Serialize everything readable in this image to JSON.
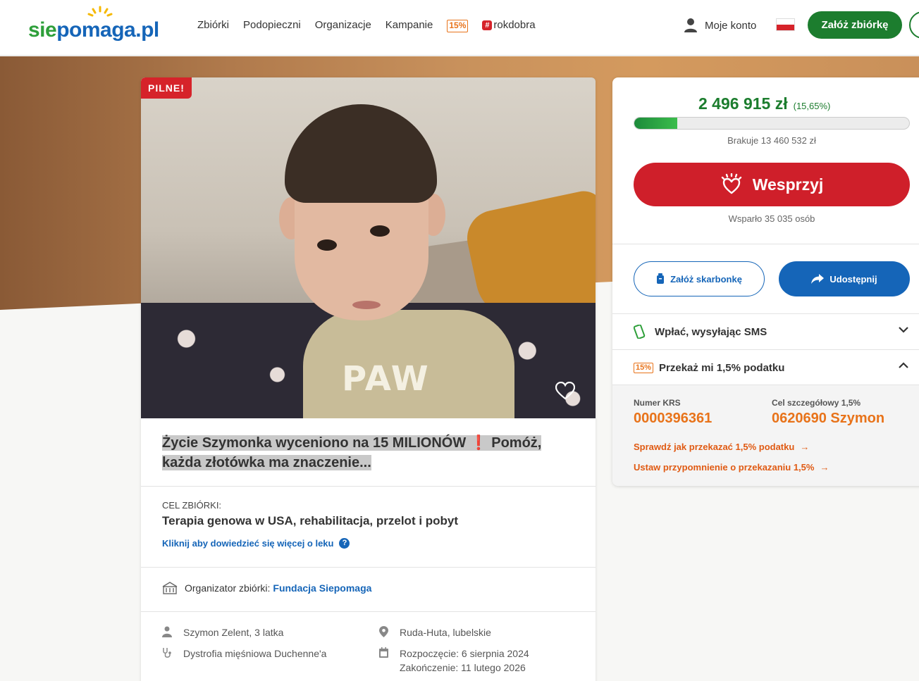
{
  "header": {
    "logo": {
      "part1": "sie",
      "part2": "pomaga",
      "part3": ".pl"
    },
    "nav": [
      "Zbiórki",
      "Podopieczni",
      "Organizacje",
      "Kampanie"
    ],
    "nav_badge": "15%",
    "nav_hashtag": "rokdobra",
    "account_label": "Moje konto",
    "create_button": "Załóż zbiórkę"
  },
  "campaign": {
    "urgent_badge": "PILNE!",
    "title_part1": "Życie Szymonka wyceniono na 15 MILIONÓW",
    "title_exclaim": "❗",
    "title_part2": "Pomóż, każda złotówka ma znaczenie...",
    "goal_label": "CEL ZBIÓRKI:",
    "goal_text": "Terapia genowa w USA, rehabilitacja, przelot i pobyt",
    "goal_link": "Kliknij aby dowiedzieć się więcej o leku",
    "goal_link_icon": "?",
    "organizer_label": "Organizator zbiórki:",
    "organizer_name": "Fundacja Siepomaga",
    "beneficiary": "Szymon Zelent, 3 latka",
    "diagnosis": "Dystrofia mięśniowa Duchenne'a",
    "location": "Ruda-Huta, lubelskie",
    "start_date": "Rozpoczęcie: 6 sierpnia 2024",
    "end_date": "Zakończenie: 11 lutego 2026",
    "photo_print": "PAW"
  },
  "donation": {
    "amount": "2 496 915 zł",
    "percent": "(15,65%)",
    "progress_fraction": 0.1565,
    "missing": "Brakuje 13 460 532 zł",
    "support_button": "Wesprzyj",
    "supporters": "Wsparło 35 035 osób",
    "box_button": "Załóż skarbonkę",
    "share_button": "Udostępnij",
    "sms_label": "Wpłać, wysyłając SMS",
    "tax_badge": "15%",
    "tax_label": "Przekaż mi 1,5% podatku",
    "krs_label": "Numer KRS",
    "krs_value": "0000396361",
    "target_label": "Cel szczegółowy 1,5%",
    "target_value": "0620690 Szymon",
    "link_how": "Sprawdź jak przekazać 1,5% podatku",
    "link_reminder": "Ustaw przypomnienie o przekazaniu 1,5%",
    "arrow": "→"
  },
  "colors": {
    "brand_green": "#1c7d2e",
    "brand_blue": "#1565b8",
    "support_red": "#cf1f2a",
    "tax_orange": "#e8731a"
  }
}
